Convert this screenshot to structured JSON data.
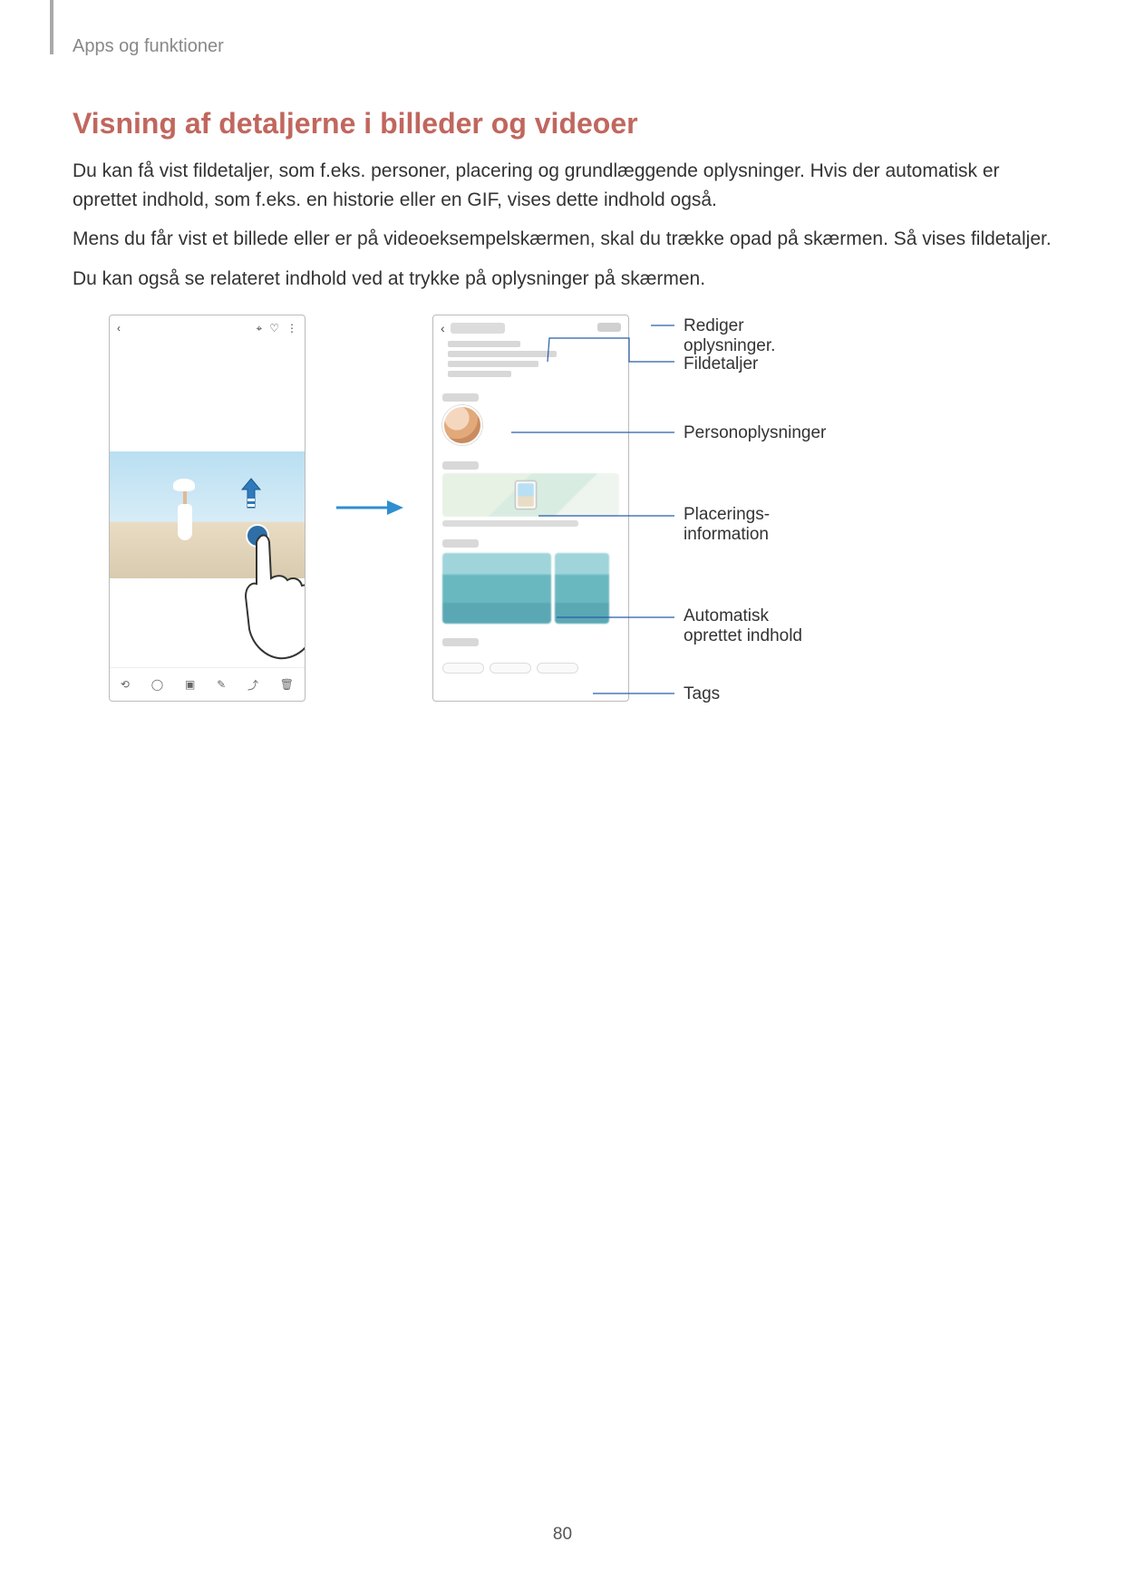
{
  "header": {
    "breadcrumb": "Apps og funktioner"
  },
  "section": {
    "title": "Visning af detaljerne i billeder og videoer",
    "p1": "Du kan få vist fildetaljer, som f.eks. personer, placering og grundlæggende oplysninger. Hvis der automatisk er oprettet indhold, som f.eks. en historie eller en GIF, vises dette indhold også.",
    "p2": "Mens du får vist et billede eller er på videoeksempelskærmen, skal du trække opad på skærmen. Så vises fildetaljer.",
    "p3": "Du kan også se relateret indhold ved at trykke på oplysninger på skærmen."
  },
  "icons": {
    "back": "‹",
    "bixby": "⌖",
    "heart": "♡",
    "more": "⋮",
    "rotate": "⟲",
    "adjust": "◯",
    "crop": "▣",
    "draw": "✎",
    "share": "⤴",
    "delete": "🗑"
  },
  "callouts": {
    "edit_info_1": "Rediger",
    "edit_info_2": "oplysninger.",
    "file_details": "Fildetaljer",
    "person_info": "Personoplysninger",
    "location_info_1": "Placerings-",
    "location_info_2": "information",
    "auto_content_1": "Automatisk",
    "auto_content_2": "oprettet indhold",
    "tags": "Tags"
  },
  "page_number": "80"
}
